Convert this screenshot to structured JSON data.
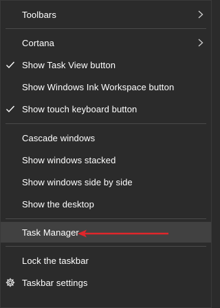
{
  "menu": {
    "items": [
      {
        "label": "Toolbars"
      },
      {
        "label": "Cortana"
      },
      {
        "label": "Show Task View button"
      },
      {
        "label": "Show Windows Ink Workspace button"
      },
      {
        "label": "Show touch keyboard button"
      },
      {
        "label": "Cascade windows"
      },
      {
        "label": "Show windows stacked"
      },
      {
        "label": "Show windows side by side"
      },
      {
        "label": "Show the desktop"
      },
      {
        "label": "Task Manager"
      },
      {
        "label": "Lock the taskbar"
      },
      {
        "label": "Taskbar settings"
      }
    ]
  },
  "colors": {
    "background": "#2b2b2b",
    "highlight": "#414141",
    "separator": "#4b4b4b",
    "text": "#ffffff",
    "annotation_arrow": "#e0262b"
  },
  "icons": {
    "check": "check-icon",
    "submenu": "chevron-right-icon",
    "settings": "gear-icon"
  }
}
